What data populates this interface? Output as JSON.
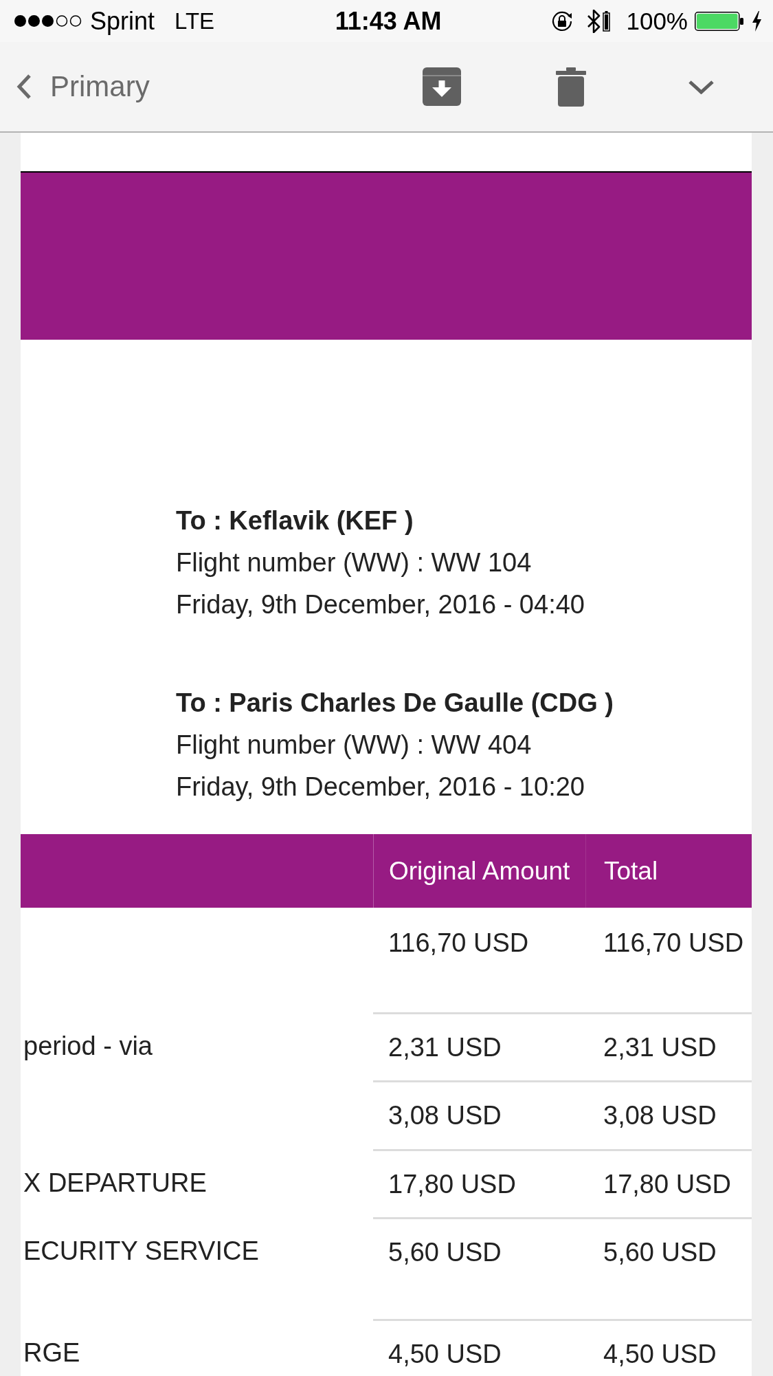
{
  "status_bar": {
    "carrier": "Sprint",
    "network": "LTE",
    "time": "11:43 AM",
    "battery_percent": "100%"
  },
  "nav_bar": {
    "back_label": "Primary"
  },
  "flights": [
    {
      "destination": "To : Keflavik (KEF )",
      "flight_number": "Flight number (WW) : WW 104",
      "departure": "Friday, 9th December, 2016 - 04:40"
    },
    {
      "destination": "To : Paris Charles De Gaulle (CDG )",
      "flight_number": "Flight number (WW) : WW 404",
      "departure": "Friday, 9th December, 2016 - 10:20"
    }
  ],
  "fare_table": {
    "columns": [
      "Original Amount",
      "Total"
    ],
    "rows": [
      {
        "original_amount": "116,70 USD",
        "total": "116,70 USD"
      },
      {
        "column_1": "period - via",
        "original_amount": "2,31 USD",
        "total": "2,31 USD"
      },
      {
        "original_amount": "3,08 USD",
        "total": "3,08 USD"
      },
      {
        "column_1": "X DEPARTURE",
        "original_amount": "17,80 USD",
        "total": "17,80 USD"
      },
      {
        "column_1": "ECURITY SERVICE",
        "original_amount": "5,60 USD",
        "total": "5,60 USD"
      },
      {
        "column_1": "RGE",
        "original_amount": "4,50 USD",
        "total": "4,50 USD"
      }
    ]
  }
}
